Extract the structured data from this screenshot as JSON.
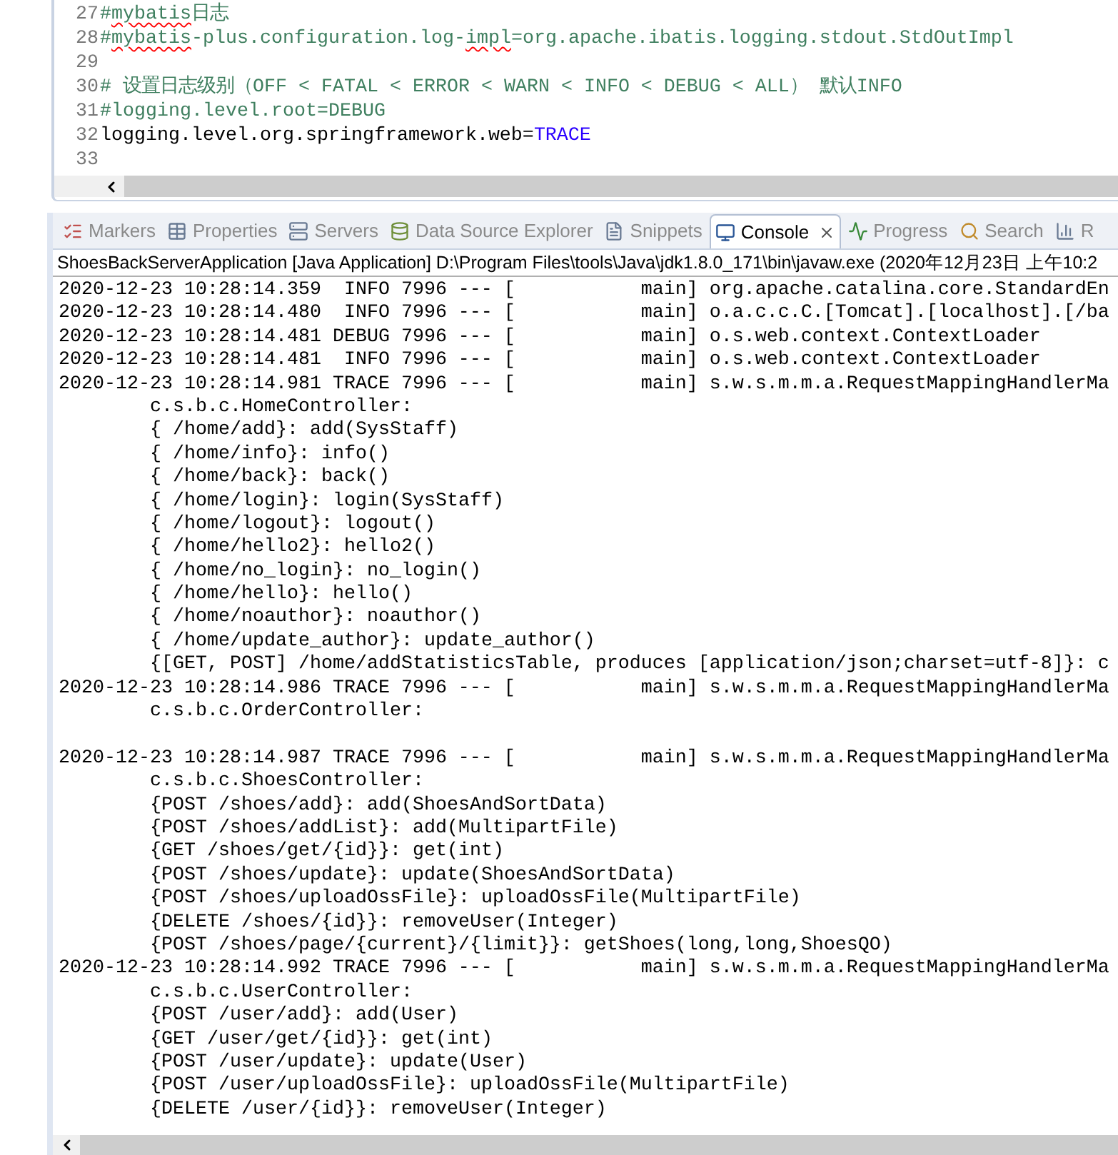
{
  "editor": {
    "lines": [
      {
        "number": "27",
        "segments": [
          {
            "text": "#",
            "kind": "comment",
            "misspelled": false
          },
          {
            "text": "mybatis",
            "kind": "comment",
            "misspelled": true
          },
          {
            "text": "日志",
            "kind": "comment",
            "misspelled": false
          }
        ]
      },
      {
        "number": "28",
        "segments": [
          {
            "text": "#",
            "kind": "comment",
            "misspelled": false
          },
          {
            "text": "mybatis",
            "kind": "comment",
            "misspelled": true
          },
          {
            "text": "-plus.configuration.log-",
            "kind": "comment",
            "misspelled": false
          },
          {
            "text": "impl",
            "kind": "comment",
            "misspelled": true
          },
          {
            "text": "=org.apache.ibatis.logging.stdout.StdOutImpl",
            "kind": "comment",
            "misspelled": false
          }
        ]
      },
      {
        "number": "29"
      },
      {
        "number": "30",
        "segments": [
          {
            "text": "# 设置日志级别（OFF < FATAL < ERROR < WARN < INFO < DEBUG < ALL） 默认INFO",
            "kind": "comment",
            "misspelled": false
          }
        ]
      },
      {
        "number": "31",
        "segments": [
          {
            "text": "#logging.level.root=DEBUG",
            "kind": "comment",
            "misspelled": false
          }
        ]
      },
      {
        "number": "32",
        "segments": [
          {
            "text": "logging.level.org.springframework.web=",
            "kind": "key",
            "misspelled": false
          },
          {
            "text": "TRACE",
            "kind": "value",
            "misspelled": false
          }
        ]
      },
      {
        "number": "33"
      }
    ]
  },
  "tabs": [
    {
      "label": "Markers",
      "selected": false,
      "closable": false
    },
    {
      "label": "Properties",
      "selected": false,
      "closable": false
    },
    {
      "label": "Servers",
      "selected": false,
      "closable": false
    },
    {
      "label": "Data Source Explorer",
      "selected": false,
      "closable": false
    },
    {
      "label": "Snippets",
      "selected": false,
      "closable": false
    },
    {
      "label": "Console",
      "selected": true,
      "closable": true
    },
    {
      "label": "Progress",
      "selected": false,
      "closable": false
    },
    {
      "label": "Search",
      "selected": false,
      "closable": false
    },
    {
      "label": "R",
      "selected": false,
      "closable": false
    }
  ],
  "console": {
    "header": "ShoesBackServerApplication [Java Application] D:\\Program Files\\tools\\Java\\jdk1.8.0_171\\bin\\javaw.exe (2020年12月23日 上午10:2",
    "lines": [
      {
        "kind": "log",
        "text": "2020-12-23 10:28:14.359  INFO 7996 --- [           main] org.apache.catalina.core.StandardEn"
      },
      {
        "kind": "log",
        "text": "2020-12-23 10:28:14.480  INFO 7996 --- [           main] o.a.c.c.C.[Tomcat].[localhost].[/ba"
      },
      {
        "kind": "log",
        "text": "2020-12-23 10:28:14.481 DEBUG 7996 --- [           main] o.s.web.context.ContextLoader"
      },
      {
        "kind": "log",
        "text": "2020-12-23 10:28:14.481  INFO 7996 --- [           main] o.s.web.context.ContextLoader"
      },
      {
        "kind": "log",
        "text": "2020-12-23 10:28:14.981 TRACE 7996 --- [           main] s.w.s.m.m.a.RequestMappingHandlerMa"
      },
      {
        "kind": "detail",
        "text": "c.s.b.c.HomeController:"
      },
      {
        "kind": "detail",
        "text": "{ /home/add}: add(SysStaff)"
      },
      {
        "kind": "detail",
        "text": "{ /home/info}: info()"
      },
      {
        "kind": "detail",
        "text": "{ /home/back}: back()"
      },
      {
        "kind": "detail",
        "text": "{ /home/login}: login(SysStaff)"
      },
      {
        "kind": "detail",
        "text": "{ /home/logout}: logout()"
      },
      {
        "kind": "detail",
        "text": "{ /home/hello2}: hello2()"
      },
      {
        "kind": "detail",
        "text": "{ /home/no_login}: no_login()"
      },
      {
        "kind": "detail",
        "text": "{ /home/hello}: hello()"
      },
      {
        "kind": "detail",
        "text": "{ /home/noauthor}: noauthor()"
      },
      {
        "kind": "detail",
        "text": "{ /home/update_author}: update_author()"
      },
      {
        "kind": "detail",
        "text": "{[GET, POST] /home/addStatisticsTable, produces [application/json;charset=utf-8]}: c"
      },
      {
        "kind": "log",
        "text": "2020-12-23 10:28:14.986 TRACE 7996 --- [           main] s.w.s.m.m.a.RequestMappingHandlerMa"
      },
      {
        "kind": "detail",
        "text": "c.s.b.c.OrderController:"
      },
      {
        "kind": "blank"
      },
      {
        "kind": "log",
        "text": "2020-12-23 10:28:14.987 TRACE 7996 --- [           main] s.w.s.m.m.a.RequestMappingHandlerMa"
      },
      {
        "kind": "detail",
        "text": "c.s.b.c.ShoesController:"
      },
      {
        "kind": "detail",
        "text": "{POST /shoes/add}: add(ShoesAndSortData)"
      },
      {
        "kind": "detail",
        "text": "{POST /shoes/addList}: add(MultipartFile)"
      },
      {
        "kind": "detail",
        "text": "{GET /shoes/get/{id}}: get(int)"
      },
      {
        "kind": "detail",
        "text": "{POST /shoes/update}: update(ShoesAndSortData)"
      },
      {
        "kind": "detail",
        "text": "{POST /shoes/uploadOssFile}: uploadOssFile(MultipartFile)"
      },
      {
        "kind": "detail",
        "text": "{DELETE /shoes/{id}}: removeUser(Integer)"
      },
      {
        "kind": "detail",
        "text": "{POST /shoes/page/{current}/{limit}}: getShoes(long,long,ShoesQO)"
      },
      {
        "kind": "log",
        "text": "2020-12-23 10:28:14.992 TRACE 7996 --- [           main] s.w.s.m.m.a.RequestMappingHandlerMa"
      },
      {
        "kind": "detail",
        "text": "c.s.b.c.UserController:"
      },
      {
        "kind": "detail",
        "text": "{POST /user/add}: add(User)"
      },
      {
        "kind": "detail",
        "text": "{GET /user/get/{id}}: get(int)"
      },
      {
        "kind": "detail",
        "text": "{POST /user/update}: update(User)"
      },
      {
        "kind": "detail",
        "text": "{POST /user/uploadOssFile}: uploadOssFile(MultipartFile)"
      },
      {
        "kind": "detail",
        "text": "{DELETE /user/{id}}: removeUser(Integer)"
      }
    ]
  }
}
